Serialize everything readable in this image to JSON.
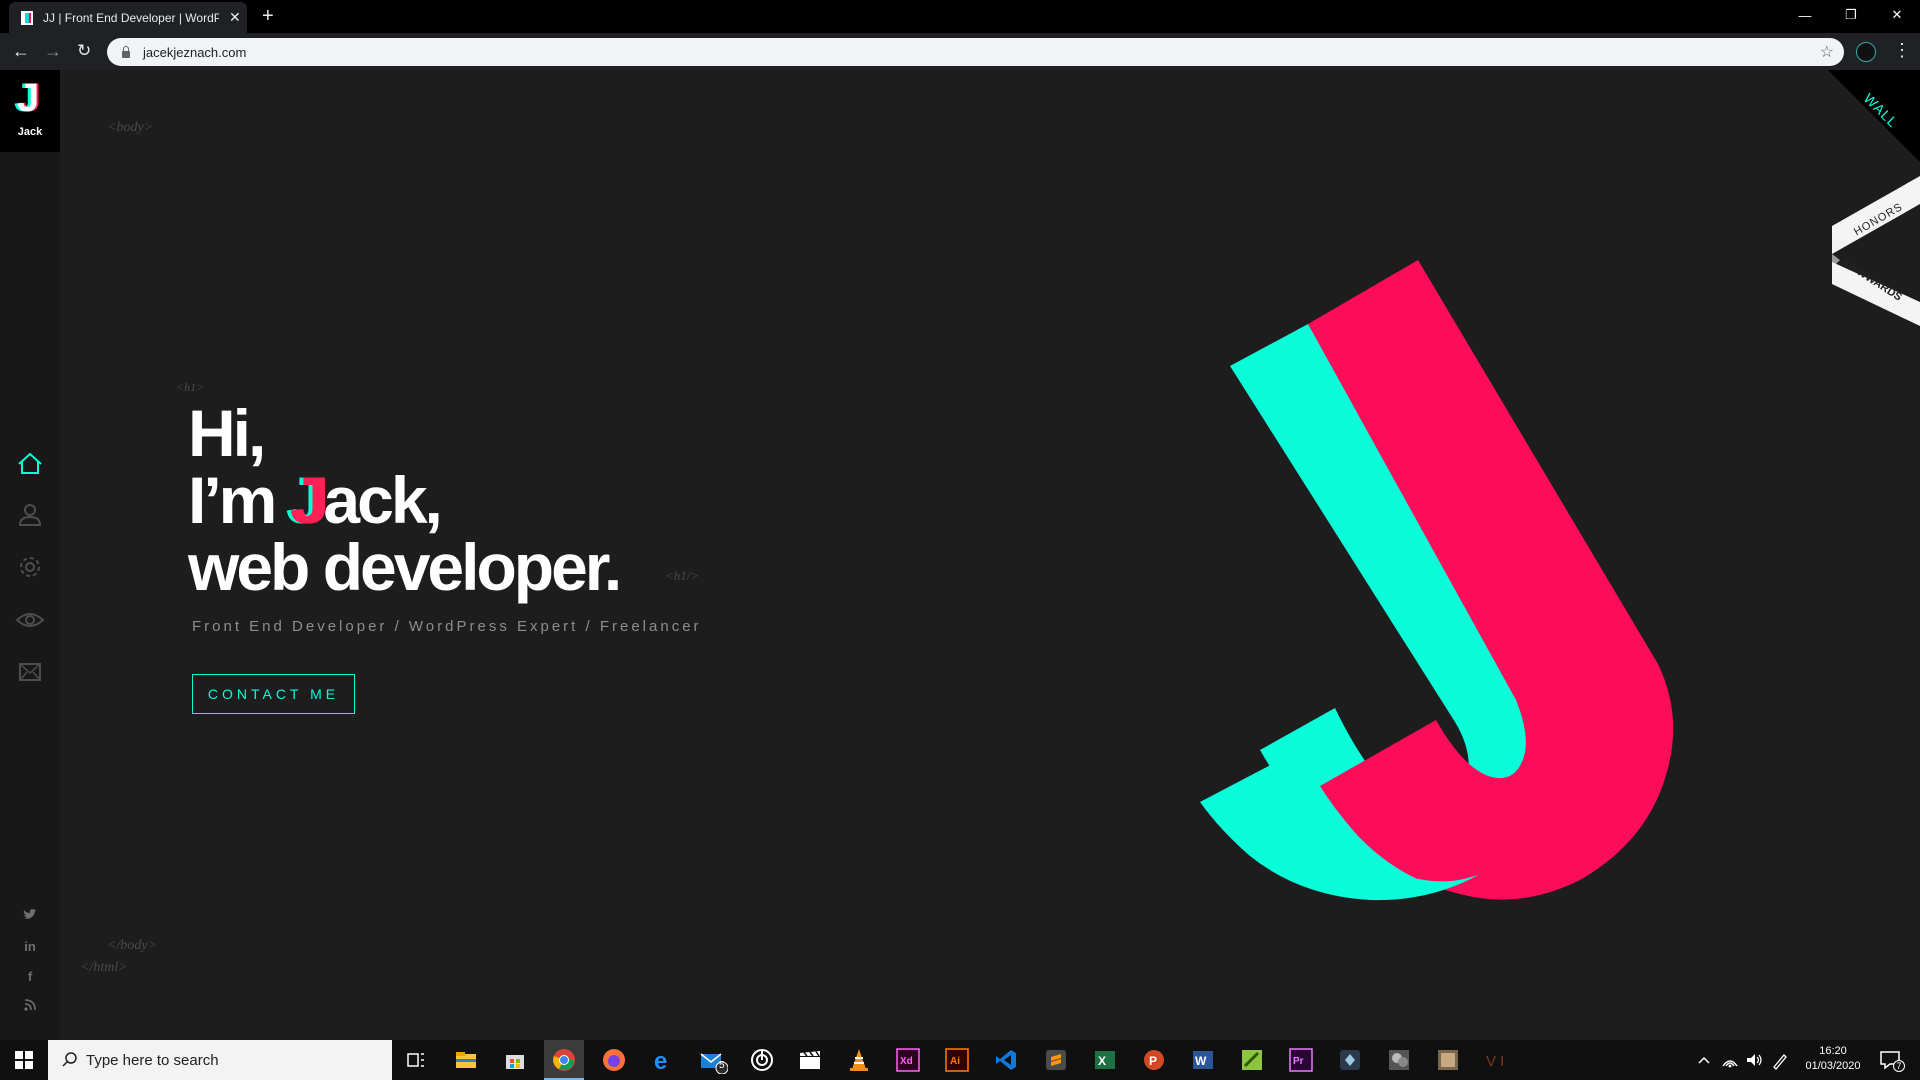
{
  "browser": {
    "tab_title": "JJ | Front End Developer | WordPress",
    "url": "jacekjeznach.com",
    "new_tab_label": "+",
    "close_tab_label": "✕"
  },
  "sidebar": {
    "logo_letter": "J",
    "logo_name": "Jack",
    "nav_items": [
      "home-icon",
      "user-icon",
      "gear-icon",
      "eye-icon",
      "mail-icon"
    ],
    "social": {
      "twitter": "🐦",
      "linkedin": "in",
      "facebook": "f",
      "rss": "RSS"
    }
  },
  "tags": {
    "body_open": "<body>",
    "h1_open": "<h1>",
    "h1_close": "<h1/>",
    "body_close": "</body>",
    "html_close": "</html>"
  },
  "hero": {
    "line1": "Hi,",
    "line2_pre": "I’m ",
    "line2_j": "J",
    "line2_post": "ack,",
    "line3": "web developer.",
    "subtitle": "Front End Developer / WordPress Expert / Freelancer",
    "contact_label": "CONTACT ME"
  },
  "corner": {
    "wall_label": "WALL",
    "honors_label": "HONORS",
    "awwwards_label": "AWWWARDS"
  },
  "taskbar": {
    "search_placeholder": "Type here to search",
    "time": "16:20",
    "date": "01/03/2020",
    "mail_badge": "5",
    "notification_badge": "7"
  },
  "colors": {
    "accent_cyan": "#08fdd8",
    "accent_pink": "#fd2155",
    "background": "#1d1d1d"
  }
}
